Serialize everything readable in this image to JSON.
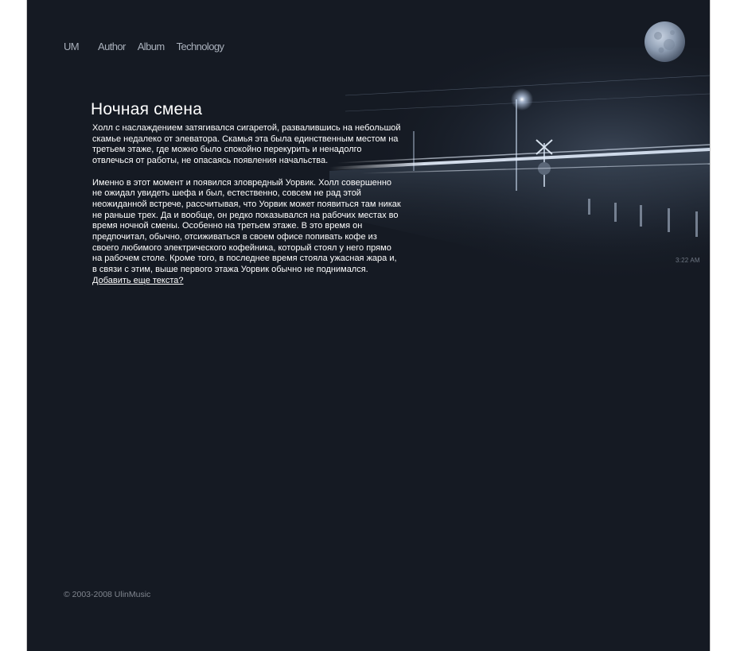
{
  "nav": {
    "logo": "UM",
    "items": [
      "Author",
      "Album",
      "Technology"
    ]
  },
  "scene": {
    "clock": "3:22 AM",
    "moon_icon": "moon-icon"
  },
  "article": {
    "title": "Ночная смена",
    "paragraphs": [
      "Холл с наслаждением затягивался сигаретой, развалившись на небольшой скамье недалеко от элеватора. Скамья эта была единственным местом на третьем этаже, где можно было спокойно перекурить и ненадолго отвлечься от работы, не опасаясь появления начальства.",
      "Именно в этот момент и появился зловредный Уорвик. Холл совершенно не ожидал увидеть шефа и был, естественно, совсем не рад этой неожиданной встрече, рассчитывая, что Уорвик может появиться там никак не раньше трех. Да и вообще, он редко показывался на рабочих местах во время ночной смены. Особенно на третьем этаже. В это время он предпочитал, обычно, отсиживаться в своем офисе попивать кофе из своего любимого электрического кофейника, который стоял у него прямо на рабочем столе. Кроме того, в последнее время стояла ужасная жара и, в связи с этим, выше первого этажа Уорвик обычно не поднимался."
    ],
    "more_link": "Добавить еще текста?"
  },
  "footer": {
    "copyright": "© 2003-2008 UlinMusic"
  },
  "colors": {
    "background": "#151a23",
    "page": "#ffffff",
    "nav_text": "#a9b0bb",
    "footer_text": "#80868f"
  }
}
